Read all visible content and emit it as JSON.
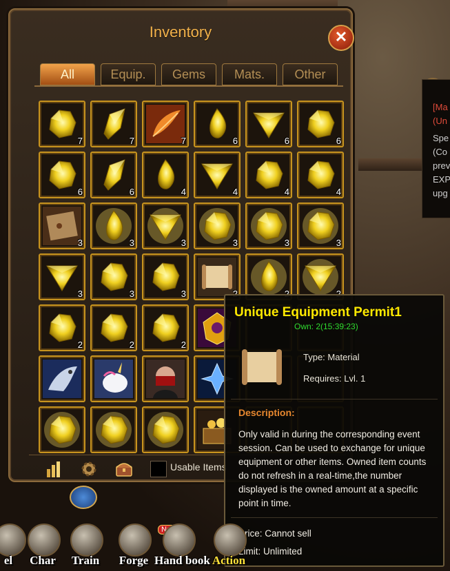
{
  "inventory": {
    "title": "Inventory",
    "tabs": [
      "All",
      "Equip.",
      "Gems",
      "Mats.",
      "Other"
    ],
    "active_tab": 0,
    "close_label": "✕",
    "items": [
      {
        "kind": "gem-rough",
        "count": "7"
      },
      {
        "kind": "gem-shard",
        "count": "7"
      },
      {
        "kind": "feather",
        "count": "7"
      },
      {
        "kind": "gem-drop",
        "count": "6"
      },
      {
        "kind": "gem-tri",
        "count": "6"
      },
      {
        "kind": "gem-rough",
        "count": "6"
      },
      {
        "kind": "gem-rough",
        "count": "6"
      },
      {
        "kind": "gem-shard",
        "count": "6"
      },
      {
        "kind": "gem-drop",
        "count": "4"
      },
      {
        "kind": "gem-tri",
        "count": "4"
      },
      {
        "kind": "gem-rough",
        "count": "4"
      },
      {
        "kind": "gem-rough",
        "count": "4"
      },
      {
        "kind": "map",
        "count": "3"
      },
      {
        "kind": "gem-drop-glow",
        "count": "3"
      },
      {
        "kind": "gem-tri-glow",
        "count": "3"
      },
      {
        "kind": "gem-rough-glow",
        "count": "3"
      },
      {
        "kind": "gem-rough-glow",
        "count": "3"
      },
      {
        "kind": "gem-rough-glow",
        "count": "3"
      },
      {
        "kind": "gem-tri",
        "count": "3"
      },
      {
        "kind": "gem-rough",
        "count": "3"
      },
      {
        "kind": "gem-rough",
        "count": "3"
      },
      {
        "kind": "scroll",
        "count": "2"
      },
      {
        "kind": "gem-drop-glow",
        "count": "2"
      },
      {
        "kind": "gem-tri-glow",
        "count": "2"
      },
      {
        "kind": "gem-rough",
        "count": "2"
      },
      {
        "kind": "gem-rough",
        "count": "2"
      },
      {
        "kind": "gem-rough",
        "count": "2"
      },
      {
        "kind": "relic",
        "count": ""
      },
      {
        "kind": "empty",
        "count": ""
      },
      {
        "kind": "empty",
        "count": ""
      },
      {
        "kind": "dragon",
        "count": ""
      },
      {
        "kind": "unicorn",
        "count": ""
      },
      {
        "kind": "ninja",
        "count": ""
      },
      {
        "kind": "crystal",
        "count": ""
      },
      {
        "kind": "empty",
        "count": ""
      },
      {
        "kind": "empty",
        "count": ""
      },
      {
        "kind": "gem-rough-glow",
        "count": ""
      },
      {
        "kind": "gem-rough-glow",
        "count": ""
      },
      {
        "kind": "gem-rough-glow",
        "count": ""
      },
      {
        "kind": "treasure",
        "count": ""
      },
      {
        "kind": "empty",
        "count": ""
      },
      {
        "kind": "empty",
        "count": ""
      }
    ],
    "usable_items_label": "Usable Items"
  },
  "tooltip": {
    "title": "Unique Equipment Permit1",
    "own": "Own: 2(15:39:23)",
    "type": "Type: Material",
    "requires": "Requires: Lvl. 1",
    "description_heading": "Description:",
    "description": "Only valid in during the corresponding event session. Can be used to exchange for unique equipment or other items. Owned item counts do not refresh in a real-time,the number displayed is the owned amount at a specific point in time.",
    "price": "Price: Cannot sell",
    "limit": "Limit: Unlimited"
  },
  "side_panel": {
    "lines": [
      "[Ma",
      "(Un",
      "Spe",
      "(Co",
      "prev",
      "EXP",
      "upg"
    ]
  },
  "nav": {
    "items": [
      {
        "label": "el"
      },
      {
        "label": "Char"
      },
      {
        "label": "Train"
      },
      {
        "label": "Forge"
      },
      {
        "label": "Hand book"
      },
      {
        "label": "Action"
      }
    ],
    "new_badge": "New"
  },
  "colors": {
    "gold": "#ffe900",
    "own_green": "#2fdc2f",
    "desc_orange": "#e8882f",
    "title_orange": "#f3b24a"
  }
}
